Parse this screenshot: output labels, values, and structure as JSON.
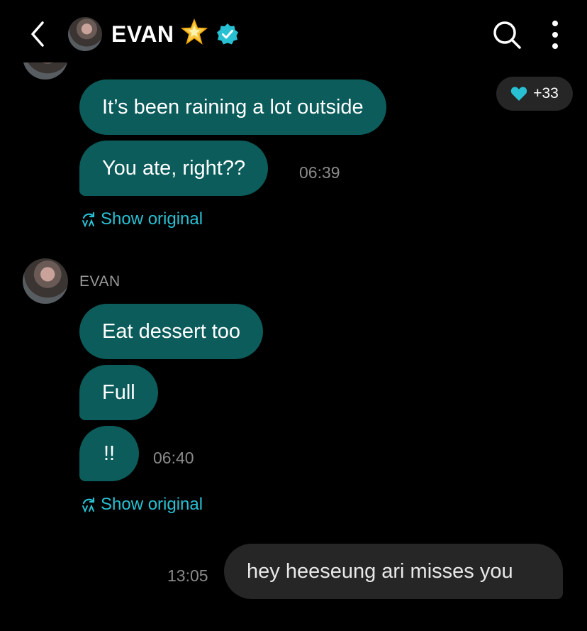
{
  "header": {
    "title": "EVAN",
    "title_emoji": "🌟",
    "icons": [
      "back-icon",
      "avatar",
      "star-icon",
      "verified-icon",
      "search-icon",
      "more-icon"
    ],
    "accent_color": "#28c0d3"
  },
  "reaction": {
    "count": "+33",
    "icon": "heart-icon"
  },
  "group1": {
    "messages": [
      "It’s been raining a lot outside",
      "You ate, right??"
    ],
    "time": "06:39",
    "show_original": "Show original"
  },
  "group2": {
    "sender": "EVAN",
    "messages": [
      "Eat dessert too",
      "Full",
      "!!"
    ],
    "time": "06:40",
    "show_original": "Show original"
  },
  "outgoing": {
    "message": "hey heeseung ari misses you",
    "time": "13:05"
  }
}
